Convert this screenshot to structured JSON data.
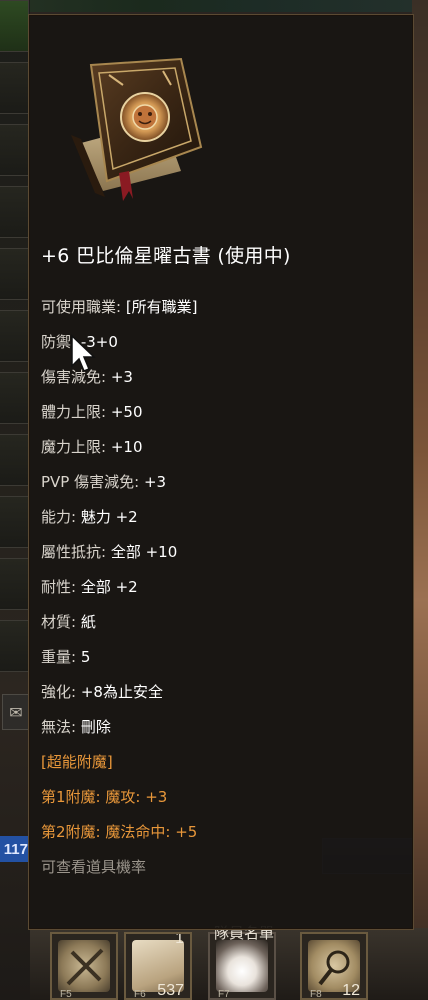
{
  "hotbar": {
    "slots": [
      {
        "key": "F5",
        "count": ""
      },
      {
        "key": "F6",
        "count": "537",
        "top_count": "1"
      },
      {
        "key": "F7",
        "count": ""
      },
      {
        "key": "F8",
        "count": "12"
      }
    ],
    "party_label": "隊員名單"
  },
  "side": {
    "hp_tag": "117"
  },
  "tooltip": {
    "item_name": "+6 巴比倫星曜古書 (使用中)",
    "stats": [
      {
        "key": "可使用職業: ",
        "value": "[所有職業]"
      },
      {
        "key": "防禦: ",
        "value": "-3+0"
      },
      {
        "key": "傷害減免: ",
        "value": "+3"
      },
      {
        "key": "體力上限: ",
        "value": "+50"
      },
      {
        "key": "魔力上限: ",
        "value": "+10"
      },
      {
        "key": "PVP 傷害減免: ",
        "value": "+3"
      },
      {
        "key": "能力: ",
        "value": "魅力 +2"
      },
      {
        "key": "屬性抵抗: ",
        "value": "全部 +10"
      },
      {
        "key": "耐性: ",
        "value": "全部 +2"
      },
      {
        "key": "材質: ",
        "value": "紙"
      },
      {
        "key": "重量: ",
        "value": "5"
      },
      {
        "key": "強化: ",
        "value": "+8為止安全"
      },
      {
        "key": "無法: ",
        "value": "刪除"
      }
    ],
    "enchant_header": "[超能附魔]",
    "enchants": [
      {
        "key": "第1附魔: ",
        "value": "魔攻: +3"
      },
      {
        "key": "第2附魔: ",
        "value": "魔法命中: +5"
      }
    ],
    "footer_link": "可查看道具機率"
  },
  "colors": {
    "enchant_orange": "#e8973a",
    "tooltip_bg": "#181512",
    "tooltip_border": "#5b4a33"
  },
  "icons": [
    "book-icon",
    "mail-icon",
    "cursor-icon",
    "sword-icon",
    "scroll-icon",
    "party-icon",
    "magnifier-icon"
  ]
}
